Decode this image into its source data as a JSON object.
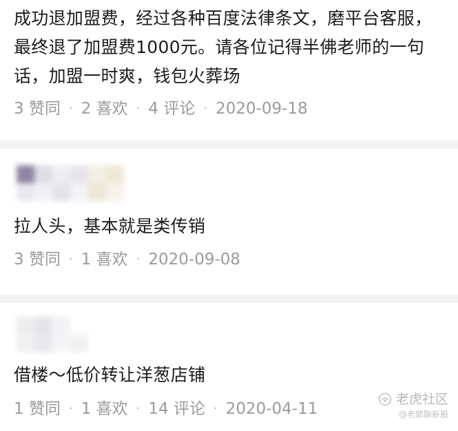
{
  "posts": [
    {
      "text": "成功退加盟费，经过各种百度法律条文，磨平台客服，最终退了加盟费1000元。请各位记得半佛老师的一句话，加盟一时爽，钱包火葬场",
      "likes": "3 赞同",
      "favs": "2 喜欢",
      "comments": "4 评论",
      "date": "2020-09-18"
    },
    {
      "text": "拉人头，基本就是类传销",
      "likes": "3 赞同",
      "favs": "1 喜欢",
      "date": "2020-09-08"
    },
    {
      "text": "借楼～低价转让洋葱店铺",
      "likes": "1 赞同",
      "favs": "1 喜欢",
      "comments": "14 评论",
      "date": "2020-04-11"
    }
  ],
  "separator": "·",
  "watermark": {
    "main": "老虎社区",
    "sub": "@老郭聊新股",
    "icon": "tiger-community-logo-icon"
  },
  "colors": {
    "text": "#1c1c1c",
    "meta": "#9b9b9b",
    "divider": "#f3f3f5",
    "avatar_accent": "#8a7f9e"
  }
}
